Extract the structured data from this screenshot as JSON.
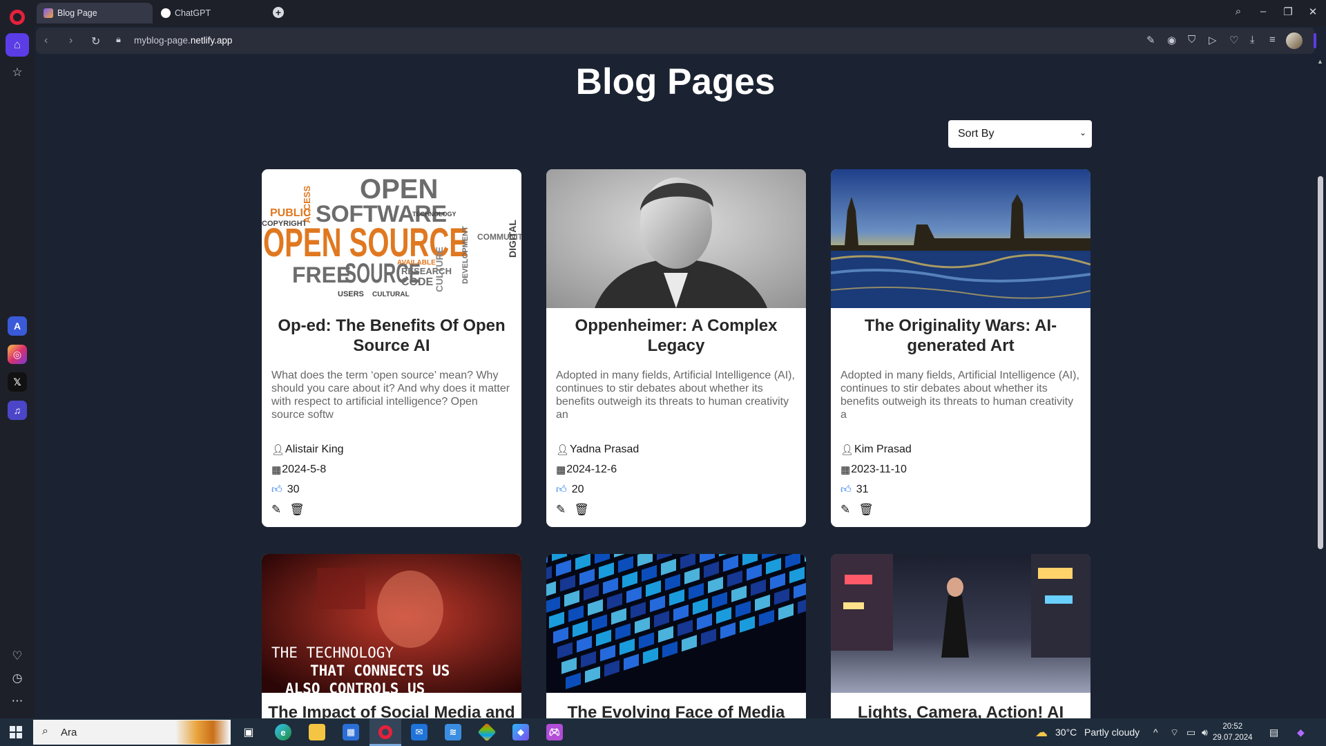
{
  "browser": {
    "tabs": [
      {
        "title": "Blog Page",
        "active": true
      },
      {
        "title": "ChatGPT",
        "active": false
      }
    ],
    "url_prefix": "myblog-page.",
    "url_domain": "netlify.app"
  },
  "page": {
    "title": "Blog Pages",
    "sort_label": "Sort By"
  },
  "posts": [
    {
      "title": "Op-ed: The Benefits Of Open Source AI",
      "description": "What does the term ‘open source’ mean? Why should you care about it? And why does it matter with respect to artificial intelligence? Open source softw",
      "author": "Alistair King",
      "date": "2024-5-8",
      "likes": "30"
    },
    {
      "title": "Oppenheimer: A Complex Legacy",
      "description": "Adopted in many fields, Artificial Intelligence (AI), continues to stir debates about whether its benefits outweigh its threats to human creativity an",
      "author": "Yadna Prasad",
      "date": "2024-12-6",
      "likes": "20"
    },
    {
      "title": "The Originality Wars: AI-generated Art",
      "description": "Adopted in many fields, Artificial Intelligence (AI), continues to stir debates about whether its benefits outweigh its threats to human creativity a",
      "author": "Kim Prasad",
      "date": "2023-11-10",
      "likes": "31"
    },
    {
      "title": "The Impact of Social Media and",
      "image_caption_1": "THE TECHNOLOGY",
      "image_caption_2": "THAT CONNECTS US",
      "image_caption_3": "ALSO CONTROLS US"
    },
    {
      "title": "The Evolving Face of Media"
    },
    {
      "title": "Lights, Camera, Action! AI"
    }
  ],
  "wordcloud": {
    "w1": "OPEN",
    "w2": "SOFTWARE",
    "w3": "OPEN SOURCE",
    "w4": "FREE",
    "w5": "SOURCE",
    "w6": "PUBLIC",
    "w7": "COPYRIGHT",
    "w8": "RESEARCH",
    "w9": "CODE",
    "w10": "CULTURE",
    "w11": "COMMUNITY",
    "w12": "DIGITAL",
    "w13": "USERS",
    "w14": "CULTURAL",
    "w15": "ACCESS",
    "w16": "AVAILABLE",
    "w17": "TECHNOLOGY",
    "w18": "DEVELOPMENT"
  },
  "taskbar": {
    "search_text": "Ara",
    "temperature": "30°C",
    "weather": "Partly cloudy",
    "time": "20:52",
    "date": "29.07.2024"
  },
  "colors": {
    "page_bg": "#1b2332",
    "accent_purple": "#5a3de6",
    "like_blue": "#1b73e8",
    "opera_red": "#e8203a"
  }
}
